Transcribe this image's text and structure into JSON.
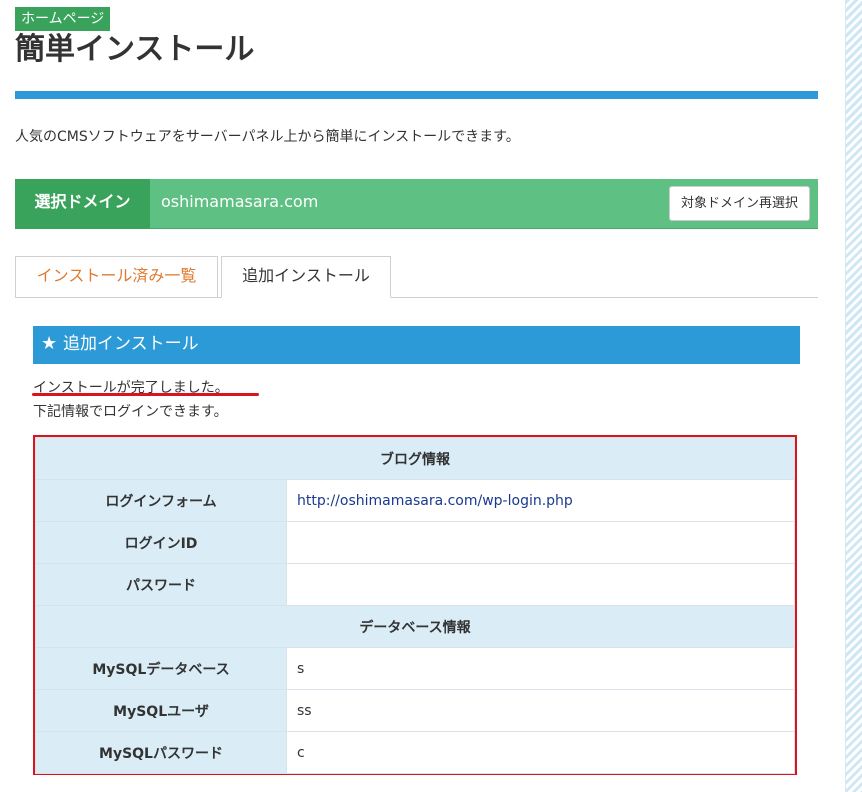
{
  "breadcrumb": {
    "label": "ホームページ"
  },
  "page": {
    "title": "簡単インストール",
    "intro": "人気のCMSソフトウェアをサーバーパネル上から簡単にインストールできます。"
  },
  "domain": {
    "label": "選択ドメイン",
    "value": "oshimamasara.com",
    "reselect_label": "対象ドメイン再選択"
  },
  "tabs": [
    {
      "label": "インストール済み一覧"
    },
    {
      "label": "追加インストール"
    }
  ],
  "section": {
    "title": "追加インストール",
    "icon": "star-icon"
  },
  "messages": {
    "complete": "インストールが完了しました。",
    "login_info": "下記情報でログインできます。"
  },
  "blog_info": {
    "heading": "ブログ情報",
    "rows": [
      {
        "label": "ログインフォーム",
        "value": "http://oshimamasara.com/wp-login.php"
      },
      {
        "label": "ログインID",
        "value": ""
      },
      {
        "label": "パスワード",
        "value": ""
      }
    ]
  },
  "db_info": {
    "heading": "データベース情報",
    "rows": [
      {
        "label": "MySQLデータベース",
        "value": "s"
      },
      {
        "label": "MySQLユーザ",
        "value": "ss"
      },
      {
        "label": "MySQLパスワード",
        "value": "c"
      }
    ]
  },
  "colors": {
    "accent_blue": "#2c9ad6",
    "green": "#3aa35b",
    "green_light": "#5ec082",
    "tab_orange": "#e07a2f",
    "highlight_red": "#d9141d"
  }
}
